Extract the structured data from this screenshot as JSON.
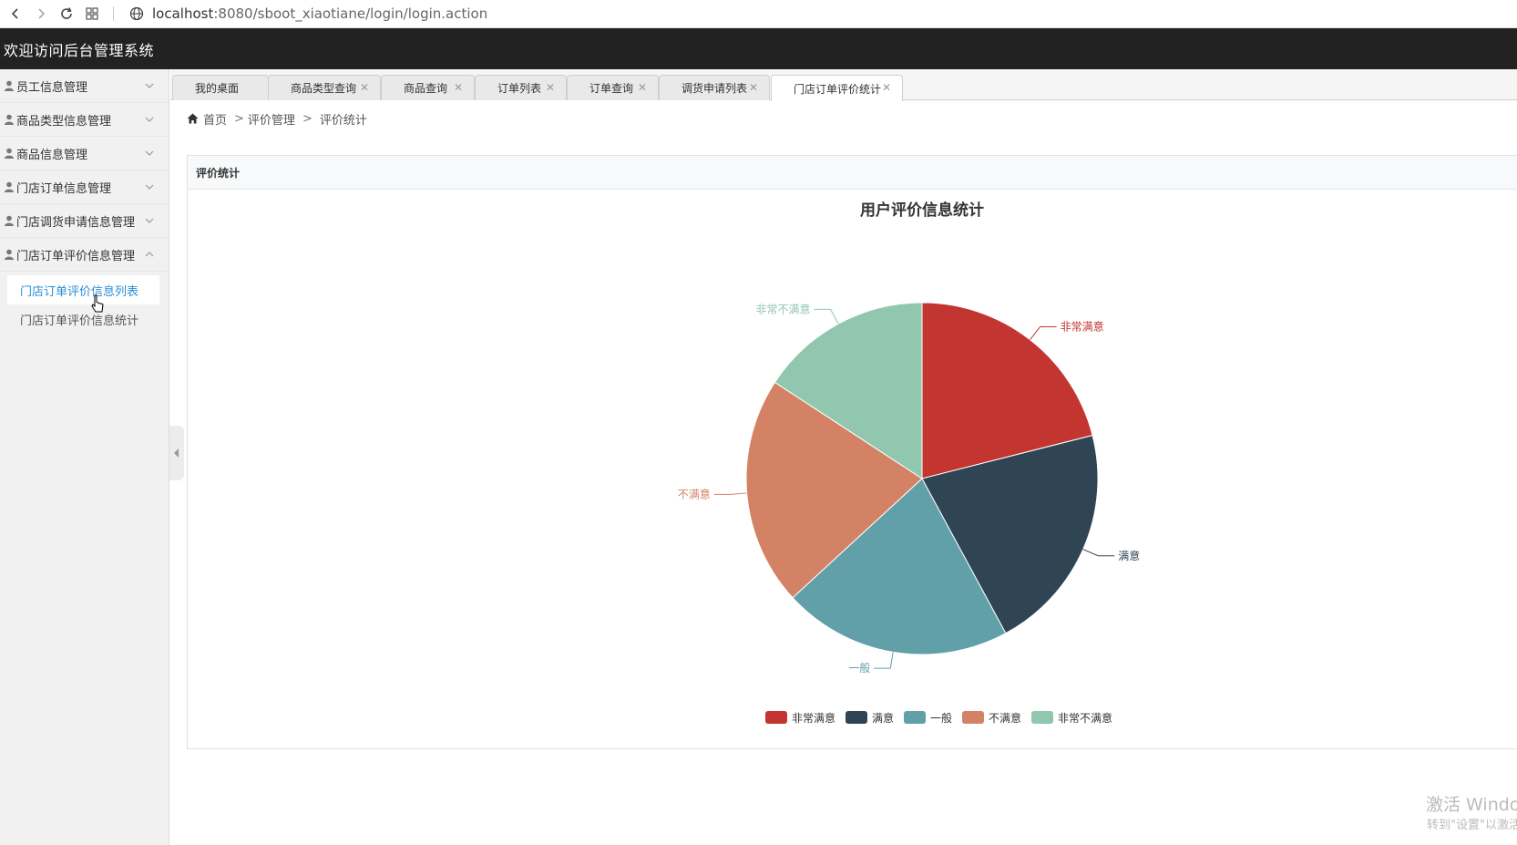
{
  "browser": {
    "url_host": "localhost",
    "url_rest": ":8080/sboot_xiaotiane/login/login.action"
  },
  "header": {
    "title": "欢迎访问后台管理系统"
  },
  "sidebar": {
    "items": [
      {
        "label": "员工信息管理",
        "expanded": false
      },
      {
        "label": "商品类型信息管理",
        "expanded": false
      },
      {
        "label": "商品信息管理",
        "expanded": false
      },
      {
        "label": "门店订单信息管理",
        "expanded": false
      },
      {
        "label": "门店调货申请信息管理",
        "expanded": false
      },
      {
        "label": "门店订单评价信息管理",
        "expanded": true
      }
    ],
    "subitems": [
      {
        "label": "门店订单评价信息列表",
        "active": true
      },
      {
        "label": "门店订单评价信息统计",
        "active": false
      }
    ]
  },
  "tabs": [
    {
      "label": "我的桌面",
      "closable": false
    },
    {
      "label": "商品类型查询",
      "closable": true
    },
    {
      "label": "商品查询",
      "closable": true
    },
    {
      "label": "订单列表",
      "closable": true
    },
    {
      "label": "订单查询",
      "closable": true
    },
    {
      "label": "调货申请列表",
      "closable": true
    },
    {
      "label": "门店订单评价统计",
      "closable": true,
      "active": true
    }
  ],
  "breadcrumb": {
    "home": "首页",
    "level1": "评价管理",
    "level2": "评价统计",
    "separator": ">"
  },
  "panel": {
    "title": "评价统计"
  },
  "chart_data": {
    "type": "pie",
    "title": "用户评价信息统计",
    "slices": [
      {
        "name": "非常满意",
        "value": 2,
        "color": "#c23531"
      },
      {
        "name": "满意",
        "value": 2,
        "color": "#2f4554"
      },
      {
        "name": "一般",
        "value": 2,
        "color": "#61a0a8"
      },
      {
        "name": "不满意",
        "value": 2,
        "color": "#d48265"
      },
      {
        "name": "非常不满意",
        "value": 1.5,
        "color": "#91c7ae"
      }
    ],
    "legend_position": "bottom"
  },
  "watermark": {
    "line1": "激活 Windows",
    "line2": "转到\"设置\"以激活Windows。"
  }
}
